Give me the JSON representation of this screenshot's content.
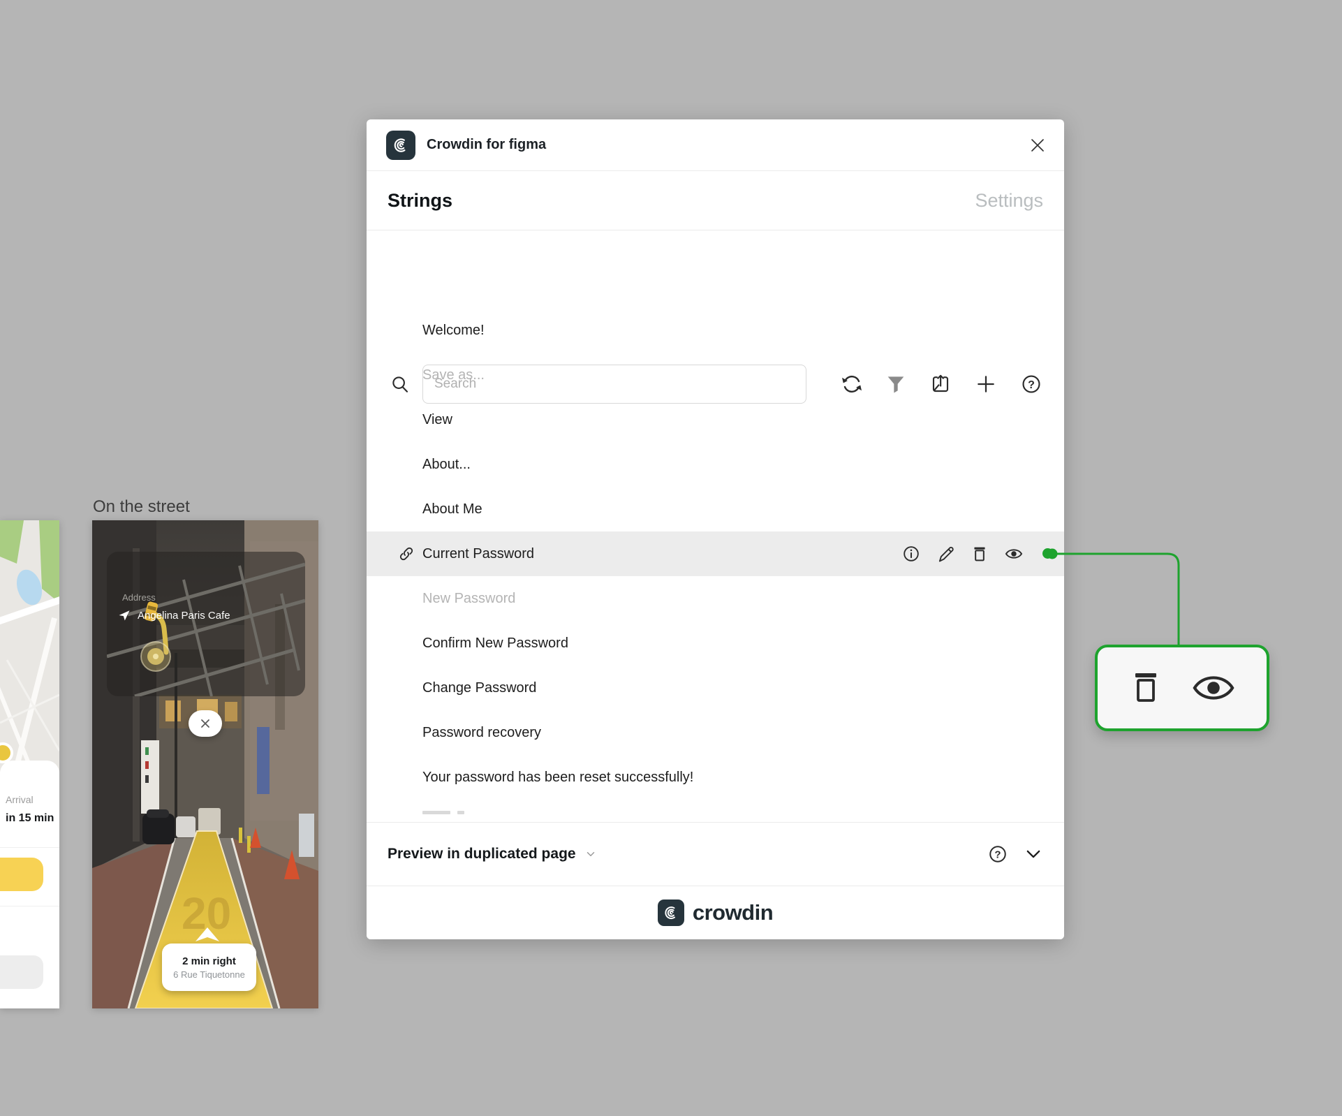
{
  "canvas": {
    "artboard_label": "On the street",
    "map_card": {
      "label": "Address",
      "value": "Angelina Paris Cafe"
    },
    "street_overlay": {
      "direction": "2 min right",
      "address": "6 Rue Tiquetonne",
      "path_number": "20"
    },
    "arrival_panel": {
      "label": "Arrival",
      "time": "in 15 min"
    }
  },
  "plugin": {
    "title": "Crowdin for figma",
    "tabs": [
      {
        "label": "Strings",
        "active": true
      },
      {
        "label": "Settings",
        "active": false
      }
    ],
    "search": {
      "placeholder": "Search"
    },
    "strings": [
      {
        "label": "Welcome!"
      },
      {
        "label": "Save as...",
        "muted": true
      },
      {
        "label": "View"
      },
      {
        "label": "About..."
      },
      {
        "label": "About Me"
      },
      {
        "label": "Current Password",
        "selected": true
      },
      {
        "label": "New Password",
        "muted": true
      },
      {
        "label": "Confirm New Password"
      },
      {
        "label": "Change Password"
      },
      {
        "label": "Password recovery"
      },
      {
        "label": "Your password has been reset successfully!"
      }
    ],
    "preview_bar": {
      "label": "Preview in duplicated page"
    },
    "footer_wordmark": "crowdin"
  },
  "icons": {
    "help_glyph": "?"
  },
  "colors": {
    "accent_green": "#1ea32e",
    "selected_row": "#ececec",
    "canvas_background": "#b5b5b5",
    "crowdin_dark": "#26343c",
    "muted_text": "#b4b4b4",
    "taxi_yellow": "#f7d254"
  }
}
